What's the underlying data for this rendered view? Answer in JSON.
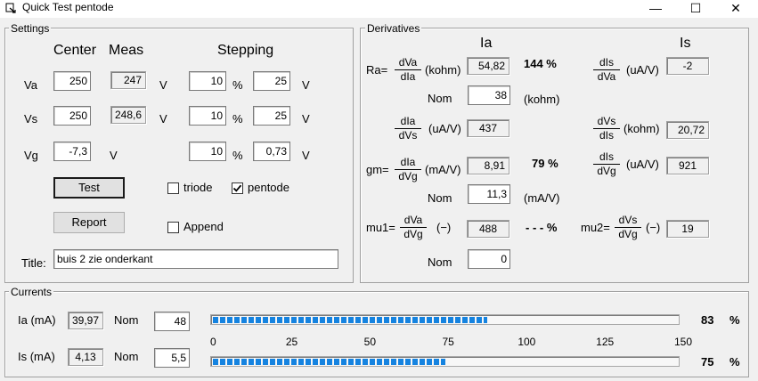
{
  "window": {
    "title": "Quick Test pentode",
    "minimize_glyph": "—",
    "maximize_glyph": "☐",
    "close_glyph": "✕"
  },
  "settings": {
    "caption": "Settings",
    "headers": {
      "center": "Center",
      "meas": "Meas",
      "stepping": "Stepping"
    },
    "rows": [
      {
        "label": "Va",
        "center": "250",
        "meas": "247",
        "unit": "V",
        "step_pct": "10",
        "pct_sign": "%",
        "step_val": "25",
        "step_unit": "V"
      },
      {
        "label": "Vs",
        "center": "250",
        "meas": "248,6",
        "unit": "V",
        "step_pct": "10",
        "pct_sign": "%",
        "step_val": "25",
        "step_unit": "V"
      },
      {
        "label": "Vg",
        "center": "-7,3",
        "unit": "V",
        "step_pct": "10",
        "pct_sign": "%",
        "step_val": "0,73",
        "step_unit": "V"
      }
    ],
    "test_button": "Test",
    "report_button": "Report",
    "triode_label": "triode",
    "triode_checked": false,
    "pentode_label": "pentode",
    "pentode_checked": true,
    "append_label": "Append",
    "append_checked": false,
    "title_label": "Title:",
    "title_value": "buis 2 zie onderkant"
  },
  "derivatives": {
    "caption": "Derivatives",
    "col_ia": "Ia",
    "col_is": "Is",
    "ra": {
      "label": "Ra=",
      "num": "dVa",
      "den": "dIa",
      "unit": "(kohm)",
      "value": "54,82",
      "pct": "144 %"
    },
    "ra_nom": {
      "label": "Nom",
      "value": "38",
      "unit": "(kohm)"
    },
    "dis_dva": {
      "num": "dIs",
      "den": "dVa",
      "unit": "(uA/V)",
      "value": "-2"
    },
    "dia_dvs": {
      "num": "dIa",
      "den": "dVs",
      "unit": "(uA/V)",
      "value": "437"
    },
    "dvs_dis": {
      "num": "dVs",
      "den": "dIs",
      "unit": "(kohm)",
      "value": "20,72"
    },
    "gm": {
      "label": "gm=",
      "num": "dIa",
      "den": "dVg",
      "unit": "(mA/V)",
      "value": "8,91",
      "pct": "79 %"
    },
    "dis_dvg": {
      "num": "dIs",
      "den": "dVg",
      "unit": "(uA/V)",
      "value": "921"
    },
    "gm_nom": {
      "label": "Nom",
      "value": "11,3",
      "unit": "(mA/V)"
    },
    "mu1": {
      "label": "mu1=",
      "num": "dVa",
      "den": "dVg",
      "unit": "(−)",
      "value": "488",
      "pct": "- - -  %"
    },
    "mu2": {
      "label": "mu2=",
      "num": "dVs",
      "den": "dVg",
      "unit": "(−)",
      "value": "19"
    },
    "mu_nom": {
      "label": "Nom",
      "value": "0"
    }
  },
  "currents": {
    "caption": "Currents",
    "ia": {
      "label": "Ia (mA)",
      "value": "39,97",
      "nom_label": "Nom",
      "nom_value": "48",
      "pct_value": "83",
      "pct_sign": "%",
      "bar_value": 88.6
    },
    "is": {
      "label": "Is (mA)",
      "value": "4,13",
      "nom_label": "Nom",
      "nom_value": "5,5",
      "pct_value": "75",
      "pct_sign": "%",
      "bar_value": 75
    },
    "scale_ticks": [
      "0",
      "25",
      "50",
      "75",
      "100",
      "125",
      "150"
    ],
    "scale_max": 150,
    "bar_color": "#1583e0"
  }
}
